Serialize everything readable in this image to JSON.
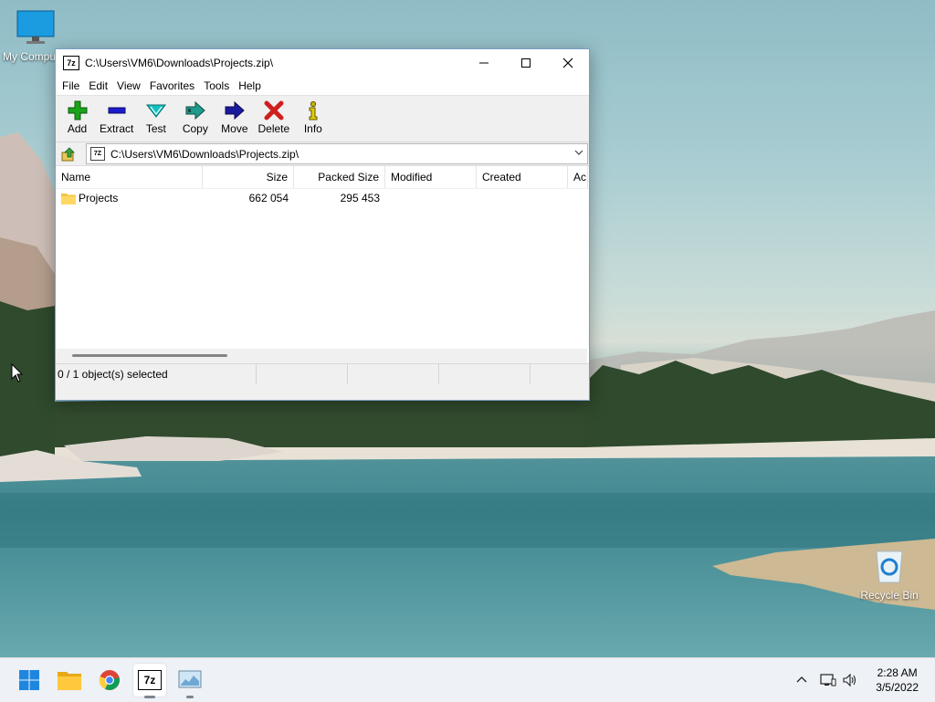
{
  "desktop": {
    "icons": [
      {
        "label": "My Computer",
        "icon": "monitor-icon"
      },
      {
        "label": "Recycle Bin",
        "icon": "recycle-bin-icon"
      }
    ]
  },
  "window": {
    "title": "C:\\Users\\VM6\\Downloads\\Projects.zip\\",
    "app_icon_text": "7z",
    "menu": [
      "File",
      "Edit",
      "View",
      "Favorites",
      "Tools",
      "Help"
    ],
    "toolbar": [
      {
        "label": "Add",
        "icon": "add-plus-icon",
        "color": "#1aa31a"
      },
      {
        "label": "Extract",
        "icon": "extract-minus-icon",
        "color": "#1c1ccc"
      },
      {
        "label": "Test",
        "icon": "test-check-icon",
        "color": "#16b8b8"
      },
      {
        "label": "Copy",
        "icon": "copy-arrow-icon",
        "color": "#1e9b8b"
      },
      {
        "label": "Move",
        "icon": "move-arrow-icon",
        "color": "#1a1a9c"
      },
      {
        "label": "Delete",
        "icon": "delete-x-icon",
        "color": "#d01f1f"
      },
      {
        "label": "Info",
        "icon": "info-icon",
        "color": "#c9b400"
      }
    ],
    "address": {
      "path": "C:\\Users\\VM6\\Downloads\\Projects.zip\\",
      "icon_text": "7Z"
    },
    "columns": [
      "Name",
      "Size",
      "Packed Size",
      "Modified",
      "Created",
      "Ac"
    ],
    "rows": [
      {
        "name": "Projects",
        "size": "662 054",
        "packed": "295 453",
        "modified": "",
        "created": ""
      }
    ],
    "status": "0 / 1 object(s) selected"
  },
  "taskbar": {
    "apps": [
      {
        "name": "start",
        "icon": "windows-start-icon"
      },
      {
        "name": "file-explorer",
        "icon": "folder-icon"
      },
      {
        "name": "chrome",
        "icon": "chrome-icon"
      },
      {
        "name": "7-zip",
        "icon": "7zip-icon",
        "text": "7z",
        "active": true
      },
      {
        "name": "resource-monitor",
        "icon": "monitor-chart-icon"
      }
    ],
    "clock_time": "2:28 AM",
    "clock_date": "3/5/2022"
  }
}
